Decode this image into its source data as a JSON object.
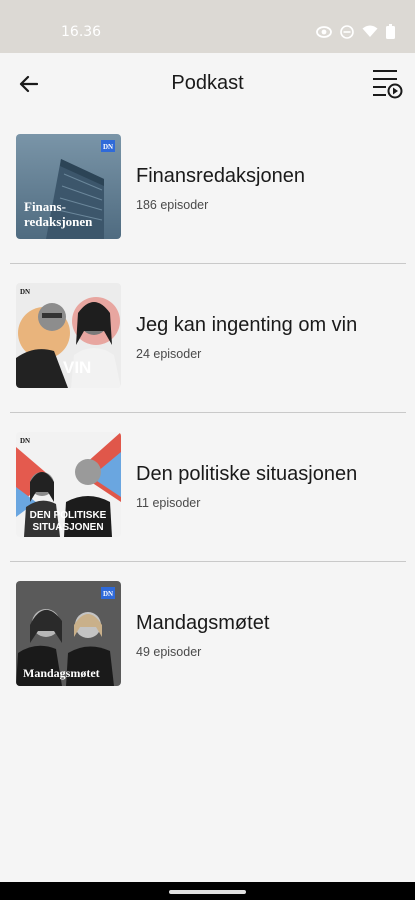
{
  "status": {
    "time": "16.36"
  },
  "appbar": {
    "title": "Podkast"
  },
  "podcasts": [
    {
      "title": "Finansredaksjonen",
      "episodes": "186 episoder",
      "art_line1": "Finans-",
      "art_line2": "redaksjonen",
      "badge": "DN"
    },
    {
      "title": "Jeg kan ingenting om vin",
      "episodes": "24 episoder",
      "art_line1": "VIN",
      "art_line2": "",
      "badge": "DN"
    },
    {
      "title": "Den politiske situasjonen",
      "episodes": "11 episoder",
      "art_line1": "DEN POLITISKE",
      "art_line2": "SITUASJONEN",
      "badge": "DN"
    },
    {
      "title": "Mandagsmøtet",
      "episodes": "49 episoder",
      "art_line1": "Mandagsmøtet",
      "art_line2": "",
      "badge": "DN"
    }
  ],
  "colors": {
    "statusbar": "#dcd9d4",
    "background": "#f5f5f5",
    "divider": "#c9c9c9",
    "accent_blue": "#2f6ad9"
  }
}
